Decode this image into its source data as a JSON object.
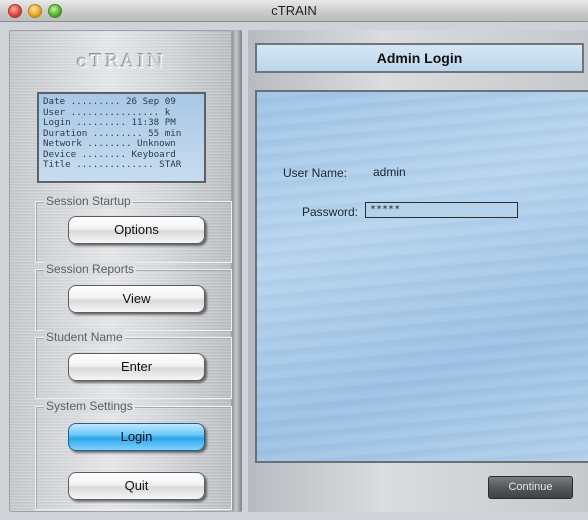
{
  "window": {
    "title": "cTRAIN"
  },
  "sidebar": {
    "logo": "cTRAIN",
    "info": [
      {
        "text": "Date ......... 26 Sep 09"
      },
      {
        "text": "User ................ k"
      },
      {
        "text": "Login ......... 11:38 PM"
      },
      {
        "text": "Duration ......... 55 min"
      },
      {
        "text": "Network ........ Unknown"
      },
      {
        "text": "Device ........ Keyboard"
      },
      {
        "text": "Title .............. STAR"
      }
    ],
    "groups": {
      "session_startup": {
        "title": "Session Startup",
        "button": "Options"
      },
      "session_reports": {
        "title": "Session Reports",
        "button": "View"
      },
      "student_name": {
        "title": "Student Name",
        "button": "Enter"
      },
      "system_settings": {
        "title": "System Settings",
        "button": "Login",
        "quit": "Quit"
      }
    }
  },
  "main": {
    "header": "Admin Login",
    "username_label": "User Name:",
    "username_value": "admin",
    "password_label": "Password:",
    "password_value": "*****",
    "continue_label": "Continue"
  }
}
